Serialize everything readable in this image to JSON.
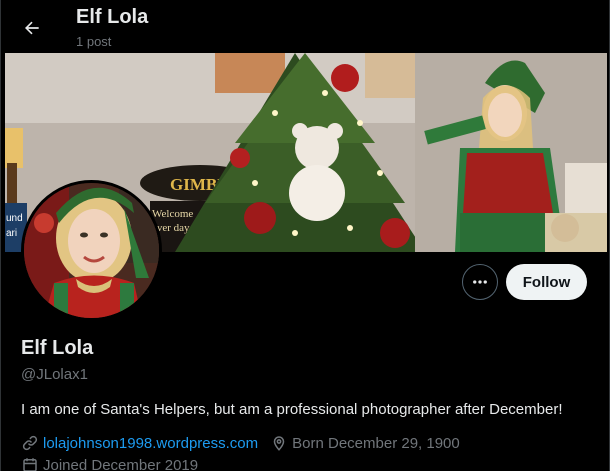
{
  "header": {
    "title": "Elf Lola",
    "post_count": "1 post",
    "back_icon": "arrow-left-icon"
  },
  "banner": {
    "sign_text": "GIMBE",
    "sign_text2": "Welcome",
    "sign_text3": "ever day",
    "side_text": "und",
    "side_text2": "ari"
  },
  "actions": {
    "more_icon": "more-horizontal-icon",
    "follow_label": "Follow"
  },
  "profile": {
    "display_name": "Elf Lola",
    "handle": "@JLolax1",
    "bio": "I am one of Santa's Helpers, but am a professional photographer after December!",
    "website": "lolajohnson1998.wordpress.com",
    "born": "Born December 29, 1900",
    "joined": "Joined December 2019"
  },
  "colors": {
    "background": "#000000",
    "text_primary": "#e7e9ea",
    "text_secondary": "#71767b",
    "link": "#1d9bf0",
    "follow_bg": "#eff3f4"
  }
}
